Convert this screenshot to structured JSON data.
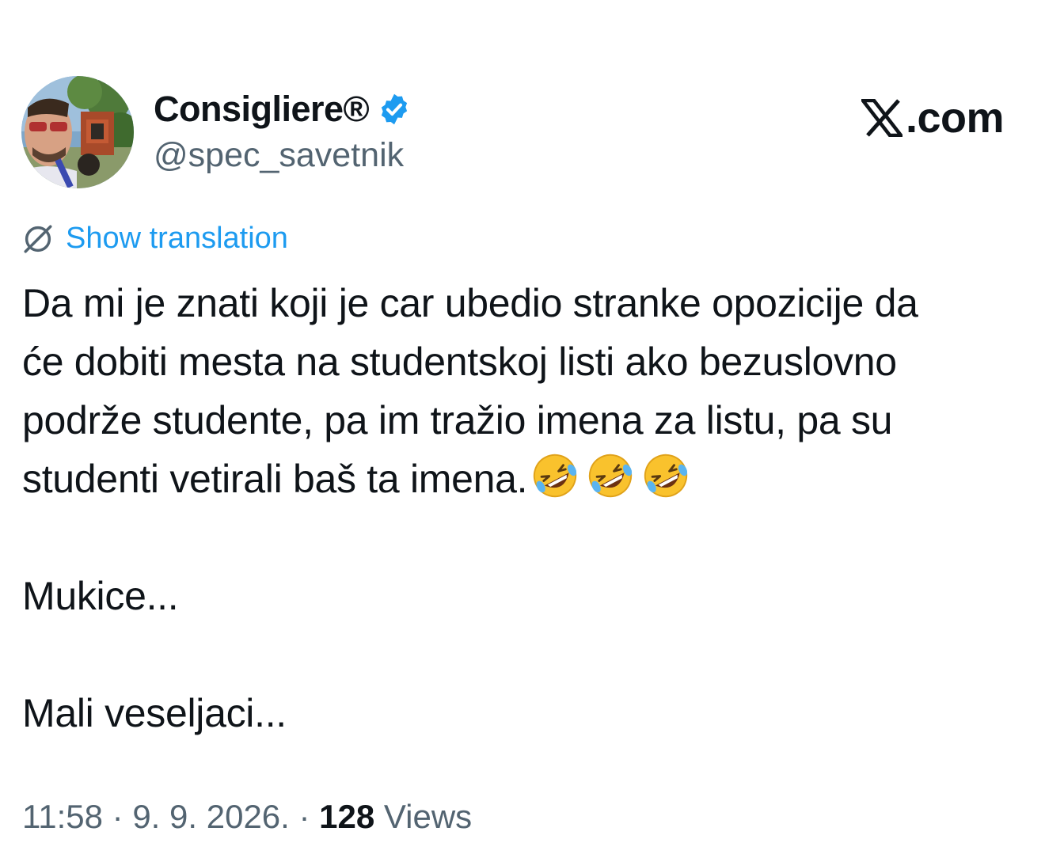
{
  "author": {
    "display_name": "Consigliere®",
    "handle": "@spec_savetnik",
    "verified": true
  },
  "brand": {
    "site": ".com",
    "logo_icon": "x-logo-icon"
  },
  "translation": {
    "label": "Show translation",
    "icon": "globe-slash-icon"
  },
  "tweet": {
    "line1": "Da mi je znati koji je car ubedio stranke opozicije da ",
    "line2": "će dobiti mesta na studentskoj listi ako bezuslovno ",
    "line3": "podrže studente, pa im tražio imena za listu, pa su ",
    "line4": "studenti vetirali baš ta imena.",
    "emojis": [
      "rolling-on-floor-laughing-emoji",
      "rolling-on-floor-laughing-emoji",
      "rolling-on-floor-laughing-emoji"
    ],
    "line5": "Mukice...",
    "line6": "Mali veseljaci..."
  },
  "meta": {
    "time": "11:58",
    "separator1": " · ",
    "date": "9. 9. 2026.",
    "separator2": " · ",
    "views_count": "128",
    "views_label": " Views"
  },
  "colors": {
    "text": "#0f1419",
    "secondary": "#536471",
    "accent": "#1d9bf0"
  }
}
